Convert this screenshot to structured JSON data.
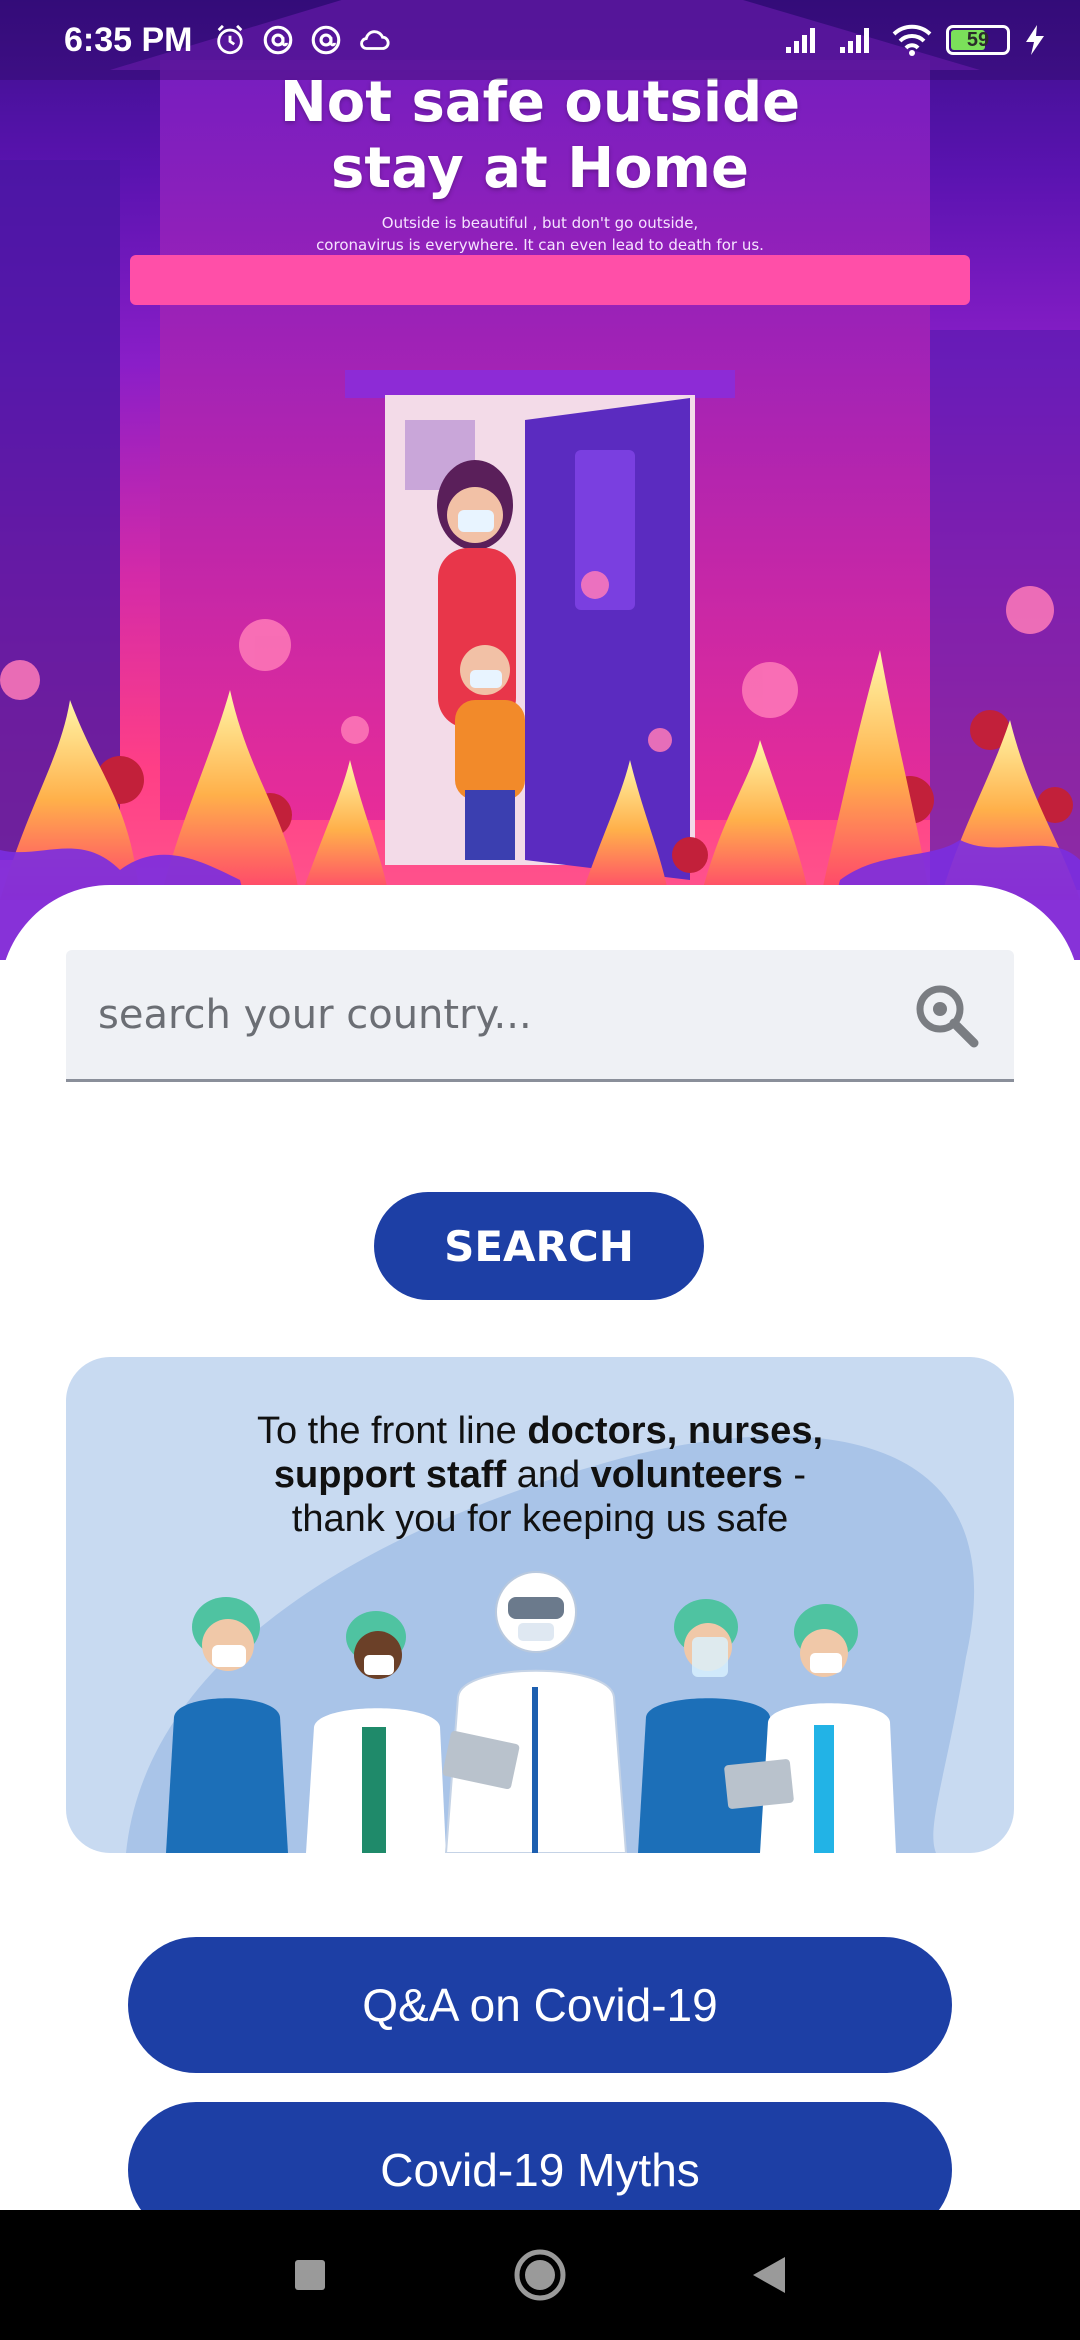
{
  "status_bar": {
    "time": "6:35 PM",
    "battery": "59",
    "icons_left": [
      "alarm-icon",
      "at-sign-icon",
      "at-sign-icon",
      "cloud-icon"
    ],
    "icons_right": [
      "signal-icon",
      "signal-icon",
      "wifi-icon",
      "battery-icon",
      "charging-icon"
    ]
  },
  "hero": {
    "title_line1": "Not safe outside",
    "title_line2": "stay at Home",
    "subtitle_line1": "Outside is beautiful , but don't go outside,",
    "subtitle_line2": "coronavirus is everywhere. It can even lead to death for us."
  },
  "search": {
    "placeholder": "search your country...",
    "button_label": "SEARCH"
  },
  "thanks_card": {
    "part1": "To the front line ",
    "bold1": "doctors, nurses,",
    "bold2": "support staff",
    "part2": " and ",
    "bold3": "volunteers",
    "part3": " -",
    "line3": "thank you for keeping us safe"
  },
  "buttons": {
    "qa_label": "Q&A on Covid-19",
    "myths_label": "Covid-19 Myths"
  },
  "nav": {
    "icons": [
      "recents-square-icon",
      "home-circle-icon",
      "back-triangle-icon"
    ]
  },
  "colors": {
    "primary": "#1d3fa5",
    "card_bg": "#c8daf1",
    "hero_top": "#3a0f8a",
    "hero_bottom": "#ff3f86"
  }
}
